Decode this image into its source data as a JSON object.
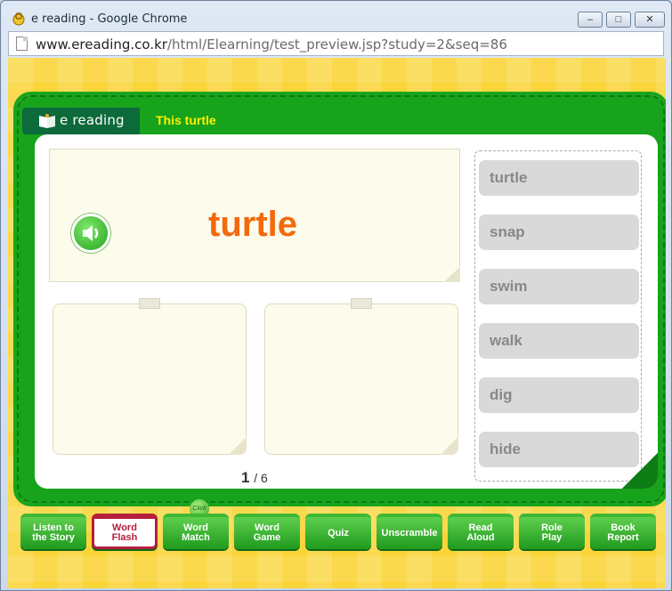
{
  "browser": {
    "window_title": "e reading - Google Chrome",
    "url_host": "www.ereading.co.kr",
    "url_path": "/html/Elearning/test_preview.jsp?study=2&seq=86"
  },
  "app": {
    "logo_text": "e reading",
    "header_title": "This  turtle",
    "current_word": "turtle",
    "page_current": "1",
    "page_total": "/ 6",
    "words": [
      "turtle",
      "snap",
      "swim",
      "walk",
      "dig",
      "hide"
    ],
    "menu": [
      {
        "line1": "Listen to",
        "line2": "the Story"
      },
      {
        "line1": "Word",
        "line2": "Flash"
      },
      {
        "line1": "Word",
        "line2": "Match"
      },
      {
        "line1": "Word",
        "line2": "Game"
      },
      {
        "line1": "Quiz",
        "line2": ""
      },
      {
        "line1": "Unscramble",
        "line2": ""
      },
      {
        "line1": "Read",
        "line2": "Aloud"
      },
      {
        "line1": "Role",
        "line2": "Play"
      },
      {
        "line1": "Book",
        "line2": "Report"
      }
    ],
    "click_badge": "Click"
  },
  "colors": {
    "board_green": "#17a31c",
    "word_orange": "#f26a0c",
    "title_yellow": "#fff000",
    "active_tab": "#b51f3d"
  }
}
